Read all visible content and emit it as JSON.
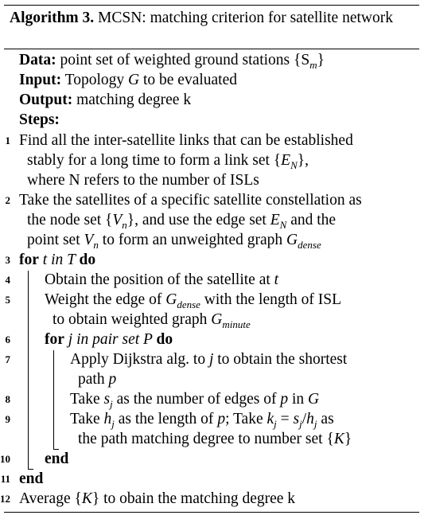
{
  "caption": {
    "label": "Algorithm 3.",
    "text": " MCSN: matching criterion for satellite network"
  },
  "header": {
    "data_label": "Data:",
    "data_text": " point set of weighted ground stations {S",
    "data_sub": "m",
    "data_close": "}",
    "input_label": "Input:",
    "input_text": " Topology ",
    "input_var": "G",
    "input_tail": " to be evaluated",
    "output_label": "Output:",
    "output_text": " matching degree k",
    "steps_label": "Steps:"
  },
  "line_numbers": [
    "1",
    "2",
    "3",
    "4",
    "5",
    "6",
    "7",
    "8",
    "9",
    "10",
    "11",
    "12"
  ],
  "lines": {
    "l1a": "Find all the inter-satellite links that can be established",
    "l1b_pre": "stably for a long time to form a link set {",
    "l1b_var": "E",
    "l1b_sub": "N",
    "l1b_post": "},",
    "l1c": "where N refers to the number of ISLs",
    "l2a": "Take the satellites of a specific satellite constellation as",
    "l2b_pre": "the node set {",
    "l2b_var": "V",
    "l2b_sub": "n",
    "l2b_mid": "}, and use the edge set ",
    "l2b_var2": "E",
    "l2b_sub2": "N",
    "l2b_post": " and the",
    "l2c_pre": "point set ",
    "l2c_var": "V",
    "l2c_sub": "n",
    "l2c_mid": " to form an unweighted graph ",
    "l2c_var2": "G",
    "l2c_sub2": "dense",
    "l3_for": "for",
    "l3_var": " t in T ",
    "l3_do": "do",
    "l4_pre": "Obtain the position of the satellite at ",
    "l4_var": "t",
    "l5a_pre": "Weight the edge of ",
    "l5a_var": "G",
    "l5a_sub": "dense",
    "l5a_post": " with the length of ISL",
    "l5b_pre": "to obtain weighted graph ",
    "l5b_var": "G",
    "l5b_sub": "minute",
    "l6_for": "for",
    "l6_var": " j in pair set P ",
    "l6_do": "do",
    "l7a_pre": "Apply Dijkstra alg. to ",
    "l7a_var": "j",
    "l7a_post": " to obtain the shortest",
    "l7b_pre": "path ",
    "l7b_var": "p",
    "l8_pre": "Take ",
    "l8_var": "s",
    "l8_sub": "j",
    "l8_mid": " as the number of edges of ",
    "l8_var2": "p",
    "l8_mid2": " in ",
    "l8_var3": "G",
    "l9a_pre": "Take ",
    "l9a_var": "h",
    "l9a_sub": "j",
    "l9a_mid": " as the length of ",
    "l9a_var2": "p",
    "l9a_mid2": "; Take ",
    "l9a_var3": "k",
    "l9a_sub3": "j",
    "l9a_eq": " = ",
    "l9a_var4": "s",
    "l9a_sub4": "j",
    "l9a_slash": "/",
    "l9a_var5": "h",
    "l9a_sub5": "j",
    "l9a_post": " as",
    "l9b_pre": "the path matching degree to number set {",
    "l9b_var": "K",
    "l9b_post": "}",
    "l10_end": "end",
    "l11_end": "end",
    "l12_pre": "Average {",
    "l12_var": "K",
    "l12_post": "} to obain the matching degree k"
  }
}
